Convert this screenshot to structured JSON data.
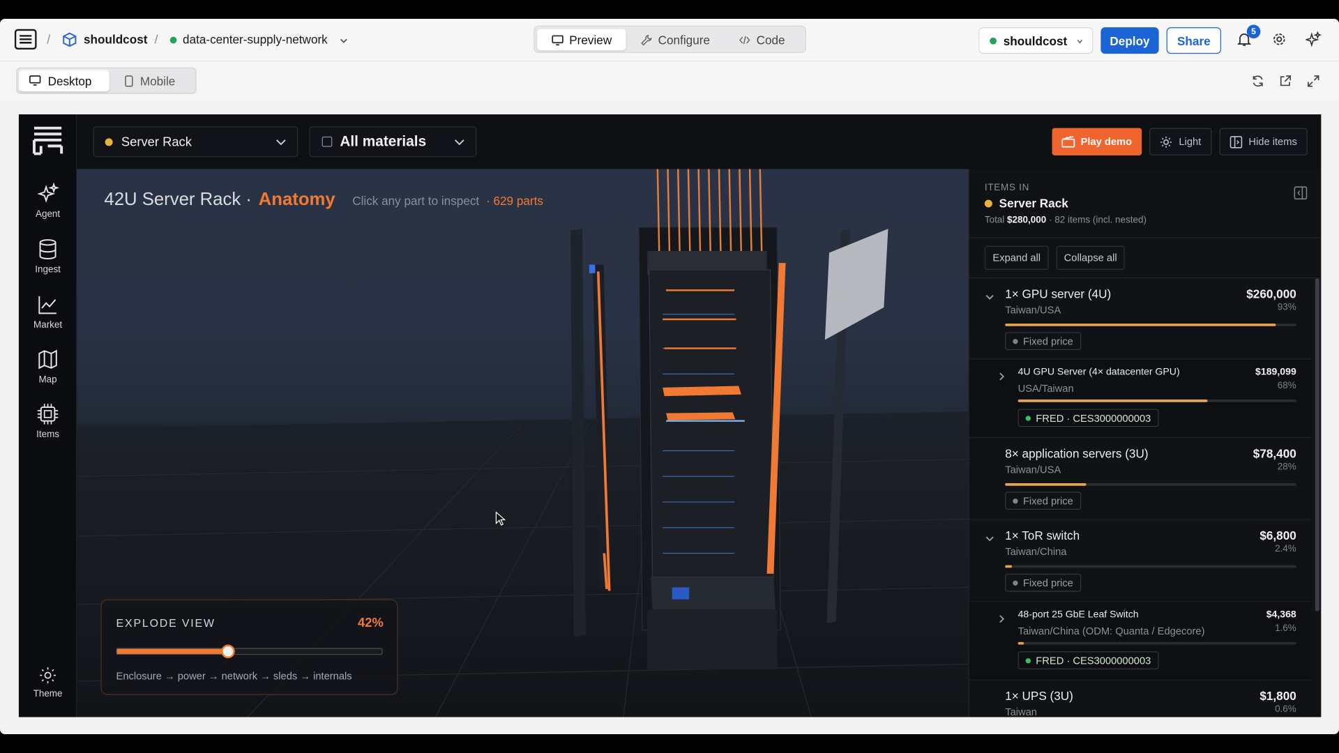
{
  "topbar": {
    "workspace": "shouldcost",
    "project": "data-center-supply-network",
    "tabs": [
      {
        "label": "Preview",
        "icon": "monitor-icon"
      },
      {
        "label": "Configure",
        "icon": "wrench-icon"
      },
      {
        "label": "Code",
        "icon": "code-icon"
      }
    ],
    "account": "shouldcost",
    "deploy": "Deploy",
    "share": "Share",
    "notifications": "5"
  },
  "subbar": {
    "devices": [
      "Desktop",
      "Mobile"
    ]
  },
  "rail": {
    "items": [
      "Agent",
      "Ingest",
      "Market",
      "Map",
      "Items"
    ],
    "theme": "Theme"
  },
  "header": {
    "assembly": "Server Rack",
    "materials": "All materials",
    "play_demo": "Play demo",
    "light": "Light",
    "hide_items": "Hide items"
  },
  "viewport": {
    "title": "42U Server Rack ·",
    "title_accent": "Anatomy",
    "hint": "Click any part to inspect",
    "parts": "· 629 parts",
    "explode_label": "EXPLODE VIEW",
    "explode_value": "42%",
    "explode_fraction": 0.42,
    "explode_desc": "Enclosure → power → network → sleds → internals"
  },
  "panel": {
    "items_in": "ITEMS IN",
    "rack": "Server Rack",
    "total_label": "Total",
    "total_value": "$280,000",
    "total_suffix": "· 82 items (incl. nested)",
    "expand_all": "Expand all",
    "collapse_all": "Collapse all",
    "items": [
      {
        "name": "1× GPU server (4U)",
        "price": "$260,000",
        "pct": "93%",
        "origin": "Taiwan/USA",
        "share": 0.93,
        "tag": "Fixed price"
      },
      {
        "name": "4U GPU Server (4× datacenter GPU)",
        "price": "$189,099",
        "pct": "68%",
        "origin": "USA/Taiwan",
        "share": 0.68,
        "tag": "FRED · CES3000000003"
      },
      {
        "name": "8× application servers (3U)",
        "price": "$78,400",
        "pct": "28%",
        "origin": "Taiwan/USA",
        "share": 0.28,
        "tag": "Fixed price"
      },
      {
        "name": "1× ToR switch",
        "price": "$6,800",
        "pct": "2.4%",
        "origin": "Taiwan/China",
        "share": 0.024,
        "tag": "Fixed price"
      },
      {
        "name": "48-port 25 GbE Leaf Switch",
        "price": "$4,368",
        "pct": "1.6%",
        "origin": "Taiwan/China (ODM: Quanta / Edgecore)",
        "share": 0.016,
        "tag": "FRED · CES3000000003"
      },
      {
        "name": "1× UPS (3U)",
        "price": "$1,800",
        "pct": "0.6%",
        "origin": "Taiwan",
        "share": 0.006
      }
    ]
  },
  "colors": {
    "accent_orange": "#f07a33",
    "deploy_blue": "#1a64d6",
    "status_green": "#22a55a",
    "rack_dot": "#e8b33a"
  }
}
